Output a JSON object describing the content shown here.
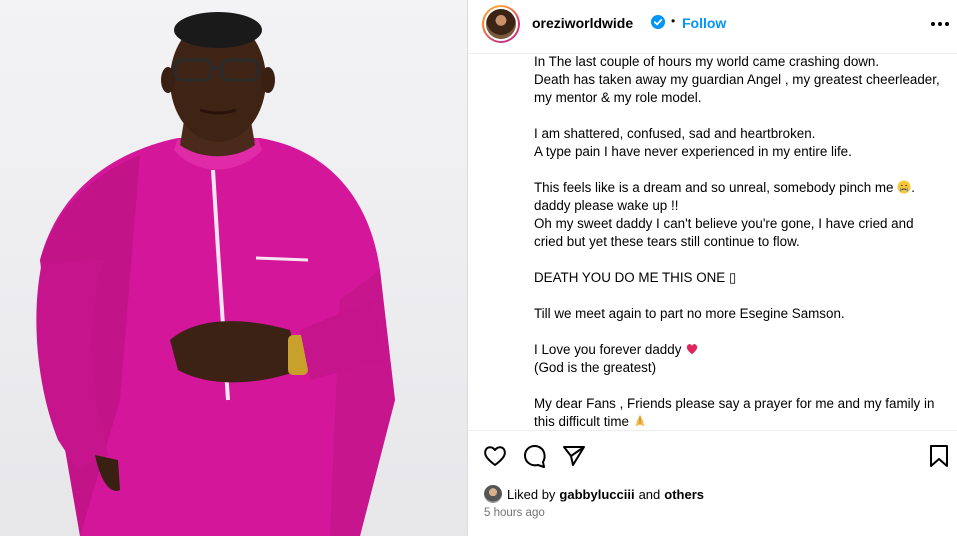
{
  "post": {
    "username": "oreziworldwide",
    "separator": "•",
    "follow_label": "Follow",
    "caption": {
      "lines": [
        "In The last couple of hours my world came crashing down.",
        "Death has taken away my guardian Angel , my greatest cheerleader,",
        "my mentor & my role model.",
        "",
        "I am shattered, confused, sad and heartbroken.",
        "A type pain I have never experienced in my entire life.",
        "",
        "This feels like is a dream and so unreal, somebody pinch me",
        "daddy please wake up !!",
        "Oh my sweet daddy I can't believe you're gone, I have cried and",
        "cried but yet these tears still continue to flow.",
        "",
        "DEATH YOU DO ME THIS ONE ▯",
        "",
        "Till we meet again to part no more Esegine Samson.",
        "",
        "I Love you forever daddy",
        "(God is the greatest)",
        "",
        "My dear Fans , Friends please say a prayer for me and my family in",
        "this difficult time"
      ],
      "line8_suffix": ".",
      "emojis": {
        "line8": "crying-face",
        "line17": "red-heart",
        "line21": "folded-hands"
      }
    },
    "likes": {
      "prefix": "Liked by",
      "user": "gabbylucciii",
      "conjunction": "and",
      "others": "others"
    },
    "timestamp": "5 hours ago",
    "accent_color": "#0095f6",
    "verified_color": "#0095f6"
  }
}
